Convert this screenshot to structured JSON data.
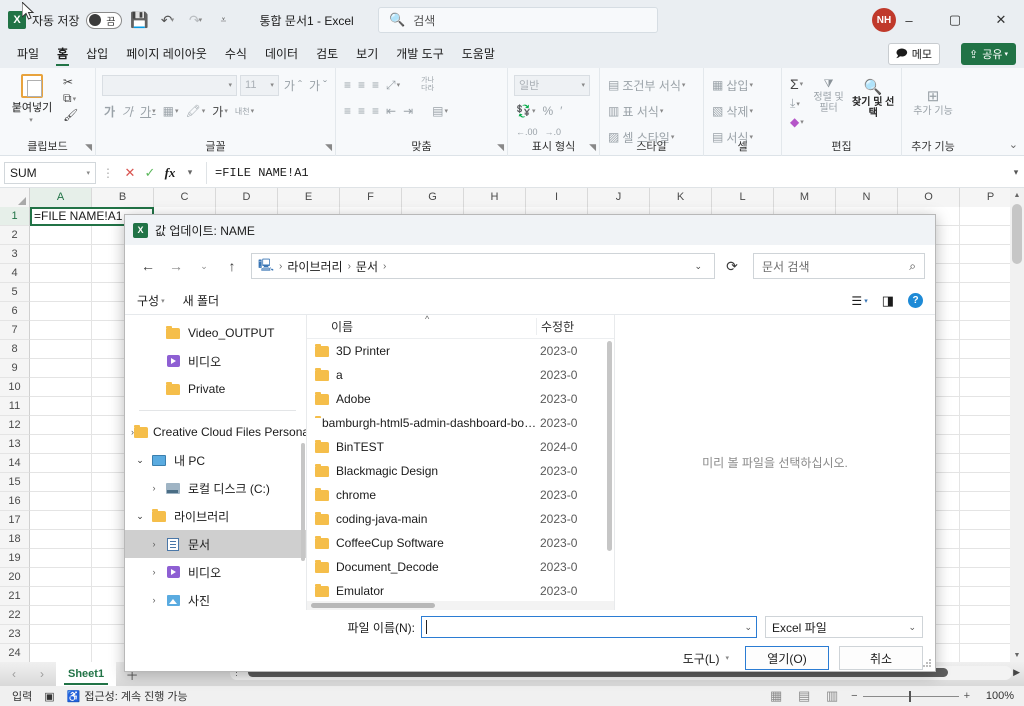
{
  "titlebar": {
    "app_icon": "excel-icon",
    "autosave_label": "자동 저장",
    "autosave_state": "끔",
    "save_icon": "save-icon",
    "undo_icon": "undo-icon",
    "redo_icon": "redo-icon",
    "customize_icon": "customize-quick-access-icon",
    "document_title": "통합 문서1  -  Excel",
    "search_placeholder": "검색",
    "search_icon": "search-icon",
    "account_initials": "NH",
    "minimize": "–",
    "maximize": "▢",
    "close": "✕"
  },
  "ribbon": {
    "tabs": [
      {
        "label": "파일",
        "active": false
      },
      {
        "label": "홈",
        "active": true
      },
      {
        "label": "삽입",
        "active": false
      },
      {
        "label": "페이지 레이아웃",
        "active": false
      },
      {
        "label": "수식",
        "active": false
      },
      {
        "label": "데이터",
        "active": false
      },
      {
        "label": "검토",
        "active": false
      },
      {
        "label": "보기",
        "active": false
      },
      {
        "label": "개발 도구",
        "active": false
      },
      {
        "label": "도움말",
        "active": false
      }
    ],
    "memo_label": "메모",
    "share_label": "공유",
    "groups": {
      "clipboard": {
        "label": "클립보드",
        "paste_label": "붙여넣기",
        "cut_label": "잘라내기",
        "copy_label": "복사",
        "format_painter_label": "서식 복사"
      },
      "font": {
        "label": "글꼴",
        "font_name": "",
        "font_size": "11",
        "grow_label": "가",
        "shrink_label": "가",
        "bold_label": "가",
        "italic_label": "가",
        "underline_label": "가",
        "border_label": "테두리",
        "fill_label": "채우기 색",
        "fontcolor_label": "가",
        "effects_label": "내천"
      },
      "alignment": {
        "label": "맞춤",
        "wrap_label": "가나\n다라",
        "merge_label": "병합하고 가운데 맞춤"
      },
      "number": {
        "label": "표시 형식",
        "format_value": "일반",
        "percent_label": "%",
        "comma_label": "′",
        "inc_dec_label": ".00",
        "dec_dec_label": ".00"
      },
      "styles": {
        "label": "스타일",
        "items": [
          "조건부 서식",
          "표 서식",
          "셀 스타일"
        ]
      },
      "cells": {
        "label": "셀",
        "items": [
          "삽입",
          "삭제",
          "서식"
        ]
      },
      "editing": {
        "label": "편집",
        "autosum_label": "Σ",
        "fill_label": "채우기",
        "clear_label": "지우기",
        "sort_filter_label": "정렬 및 필터",
        "find_select_label": "찾기 및 선택"
      },
      "addins": {
        "label": "추가 기능",
        "item_label": "추가 기능"
      }
    },
    "collapse_icon": "chevron-up-icon"
  },
  "formulabar": {
    "namebox_value": "SUM",
    "cancel_icon": "cancel-icon",
    "confirm_icon": "confirm-icon",
    "fx_icon": "fx-icon",
    "formula_value": "=FILE NAME!A1"
  },
  "grid": {
    "columns": [
      "A",
      "B",
      "C",
      "D",
      "E",
      "F",
      "G",
      "H",
      "I",
      "J",
      "K",
      "L",
      "M",
      "N",
      "O",
      "P"
    ],
    "rows": [
      "1",
      "2",
      "3",
      "4",
      "5",
      "6",
      "7",
      "8",
      "9",
      "10",
      "11",
      "12",
      "13",
      "14",
      "15",
      "16",
      "17",
      "18",
      "19",
      "20",
      "21",
      "22",
      "23",
      "24"
    ],
    "active_cell_value": "=FILE NAME!A1",
    "selected_column": "A",
    "selected_row": "1"
  },
  "sheetbar": {
    "prev_icon": "chevron-left-icon",
    "next_icon": "chevron-right-icon",
    "sheets": [
      "Sheet1"
    ],
    "add_sheet_icon": "plus-icon"
  },
  "statusbar": {
    "mode": "입력",
    "macro_icon": "record-macro-icon",
    "accessibility_icon": "accessibility-icon",
    "accessibility_label": "접근성: 계속 진행 가능",
    "view_normal_icon": "normal-view-icon",
    "view_pagelayout_icon": "page-layout-view-icon",
    "view_pagebreak_icon": "page-break-view-icon",
    "zoom_out": "−",
    "zoom_in": "+",
    "zoom_level": "100%"
  },
  "dialog": {
    "title": "값 업데이트: NAME",
    "icon": "excel-icon",
    "close_icon": "close-icon",
    "nav": {
      "back_icon": "arrow-left-icon",
      "forward_icon": "arrow-right-icon",
      "recent_icon": "chevron-down-icon",
      "up_icon": "arrow-up-icon",
      "address_icon": "computer-icon",
      "breadcrumbs": [
        "라이브러리",
        "문서"
      ],
      "address_dropdown_icon": "chevron-down-icon",
      "refresh_icon": "refresh-icon",
      "search_placeholder": "문서 검색",
      "search_icon": "search-icon"
    },
    "commandbar": {
      "organize_label": "구성",
      "new_folder_label": "새 폴더",
      "view_icon": "view-list-icon",
      "view_dropdown_icon": "chevron-down-icon",
      "preview_pane_icon": "preview-pane-icon",
      "help_icon": "help-icon"
    },
    "navpane": {
      "items": [
        {
          "label": "Video_OUTPUT",
          "icon": "folder-icon",
          "indent": 1,
          "chevron": "none",
          "selected": false
        },
        {
          "label": "비디오",
          "icon": "video-icon",
          "indent": 1,
          "chevron": "none",
          "selected": false
        },
        {
          "label": "Private",
          "icon": "folder-icon",
          "indent": 1,
          "chevron": "none",
          "selected": false
        },
        {
          "label": "Creative Cloud Files Personal",
          "icon": "folder-icon",
          "indent": 0,
          "chevron": "closed",
          "selected": false
        },
        {
          "label": "내 PC",
          "icon": "pc-icon",
          "indent": 0,
          "chevron": "open",
          "selected": false
        },
        {
          "label": "로컬 디스크 (C:)",
          "icon": "disk-icon",
          "indent": 1,
          "chevron": "closed",
          "selected": false
        },
        {
          "label": "라이브러리",
          "icon": "folder-icon",
          "indent": 0,
          "chevron": "open",
          "selected": false
        },
        {
          "label": "문서",
          "icon": "document-icon",
          "indent": 1,
          "chevron": "closed",
          "selected": true
        },
        {
          "label": "비디오",
          "icon": "video-icon",
          "indent": 1,
          "chevron": "closed",
          "selected": false
        },
        {
          "label": "사진",
          "icon": "picture-icon",
          "indent": 1,
          "chevron": "closed",
          "selected": false
        }
      ]
    },
    "filelist": {
      "header_name": "이름",
      "header_date": "수정한",
      "sort_indicator": "^",
      "rows": [
        {
          "name": "3D Printer",
          "date": "2023-0",
          "icon": "folder-icon"
        },
        {
          "name": "a",
          "date": "2023-0",
          "icon": "folder-icon"
        },
        {
          "name": "Adobe",
          "date": "2023-0",
          "icon": "folder-icon"
        },
        {
          "name": "bamburgh-html5-admin-dashboard-bo…",
          "date": "2023-0",
          "icon": "folder-icon"
        },
        {
          "name": "BinTEST",
          "date": "2024-0",
          "icon": "folder-icon"
        },
        {
          "name": "Blackmagic Design",
          "date": "2023-0",
          "icon": "folder-icon"
        },
        {
          "name": "chrome",
          "date": "2023-0",
          "icon": "folder-icon"
        },
        {
          "name": "coding-java-main",
          "date": "2023-0",
          "icon": "folder-icon"
        },
        {
          "name": "CoffeeCup Software",
          "date": "2023-0",
          "icon": "folder-icon"
        },
        {
          "name": "Document_Decode",
          "date": "2023-0",
          "icon": "folder-icon"
        },
        {
          "name": "Emulator",
          "date": "2023-0",
          "icon": "folder-icon"
        }
      ]
    },
    "preview": {
      "message": "미리 볼 파일을 선택하십시오."
    },
    "footer": {
      "filename_label": "파일 이름(N):",
      "filename_value": "",
      "filename_dropdown_icon": "chevron-down-icon",
      "filetype_value": "Excel 파일",
      "filetype_dropdown_icon": "chevron-down-icon",
      "tools_label": "도구(L)",
      "tools_dropdown_icon": "triangle-down-icon",
      "open_label": "열기(O)",
      "cancel_label": "취소"
    }
  }
}
